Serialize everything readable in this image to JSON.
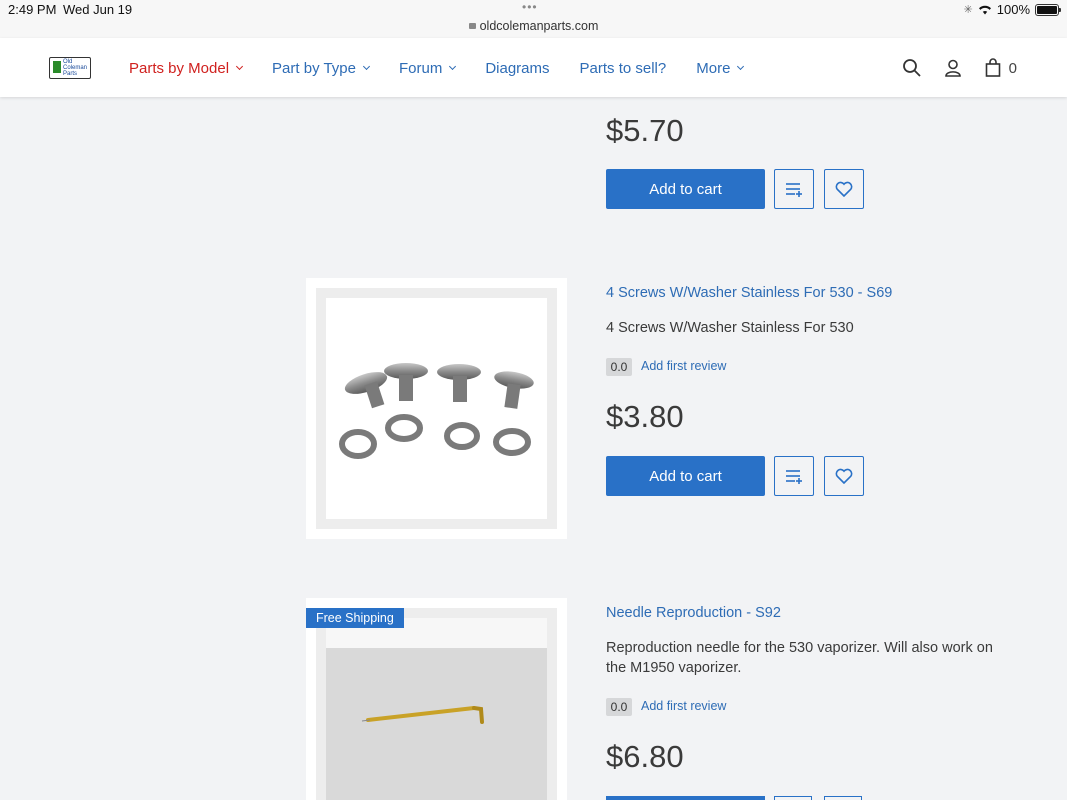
{
  "status_bar": {
    "time": "2:49 PM",
    "date": "Wed Jun 19",
    "url": "oldcolemanparts.com",
    "battery": "100%"
  },
  "header": {
    "logo_text": "Old Coleman Parts",
    "nav": [
      {
        "label": "Parts by Model",
        "has_dropdown": true,
        "active": true
      },
      {
        "label": "Part by Type",
        "has_dropdown": true
      },
      {
        "label": "Forum",
        "has_dropdown": true
      },
      {
        "label": "Diagrams",
        "has_dropdown": false
      },
      {
        "label": "Parts to sell?",
        "has_dropdown": false
      },
      {
        "label": "More",
        "has_dropdown": true
      }
    ],
    "cart_count": "0",
    "icons": [
      "search-icon",
      "user-icon",
      "cart-icon"
    ]
  },
  "colors": {
    "accent": "#2971c7",
    "link": "#2e6cb5",
    "active_nav": "#d0211f",
    "background": "#f2f3f5"
  },
  "products": [
    {
      "price": "$5.70",
      "add_to_cart": "Add to cart"
    },
    {
      "title": "4 Screws W/Washer Stainless For 530 - S69",
      "description": "4 Screws W/Washer Stainless For 530",
      "rating": "0.0",
      "review_link": "Add first review",
      "price": "$3.80",
      "add_to_cart": "Add to cart"
    },
    {
      "badge": "Free Shipping",
      "title": "Needle Reproduction - S92",
      "description": "Reproduction needle for the 530 vaporizer. Will also work on the M1950 vaporizer.",
      "rating": "0.0",
      "review_link": "Add first review",
      "price": "$6.80"
    }
  ]
}
